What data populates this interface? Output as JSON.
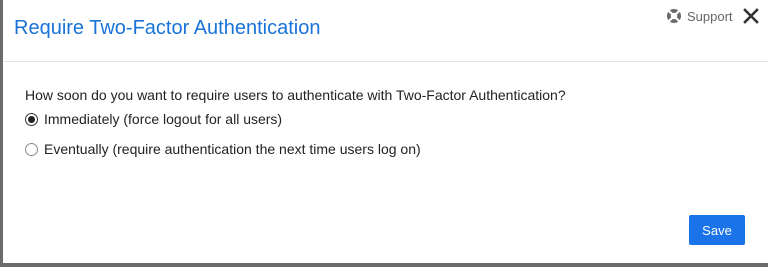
{
  "dialog": {
    "title": "Require Two-Factor Authentication",
    "support_label": "Support",
    "question": "How soon do you want to require users to authenticate with Two-Factor Authentication?",
    "options": [
      {
        "label": "Immediately (force logout for all users)",
        "selected": true
      },
      {
        "label": "Eventually (require authentication the next time users log on)",
        "selected": false
      }
    ],
    "save_label": "Save"
  },
  "icons": {
    "support": "lifebuoy-icon",
    "close": "close-icon"
  },
  "colors": {
    "title": "#1a73d9",
    "save_button": "#1a73e8"
  }
}
